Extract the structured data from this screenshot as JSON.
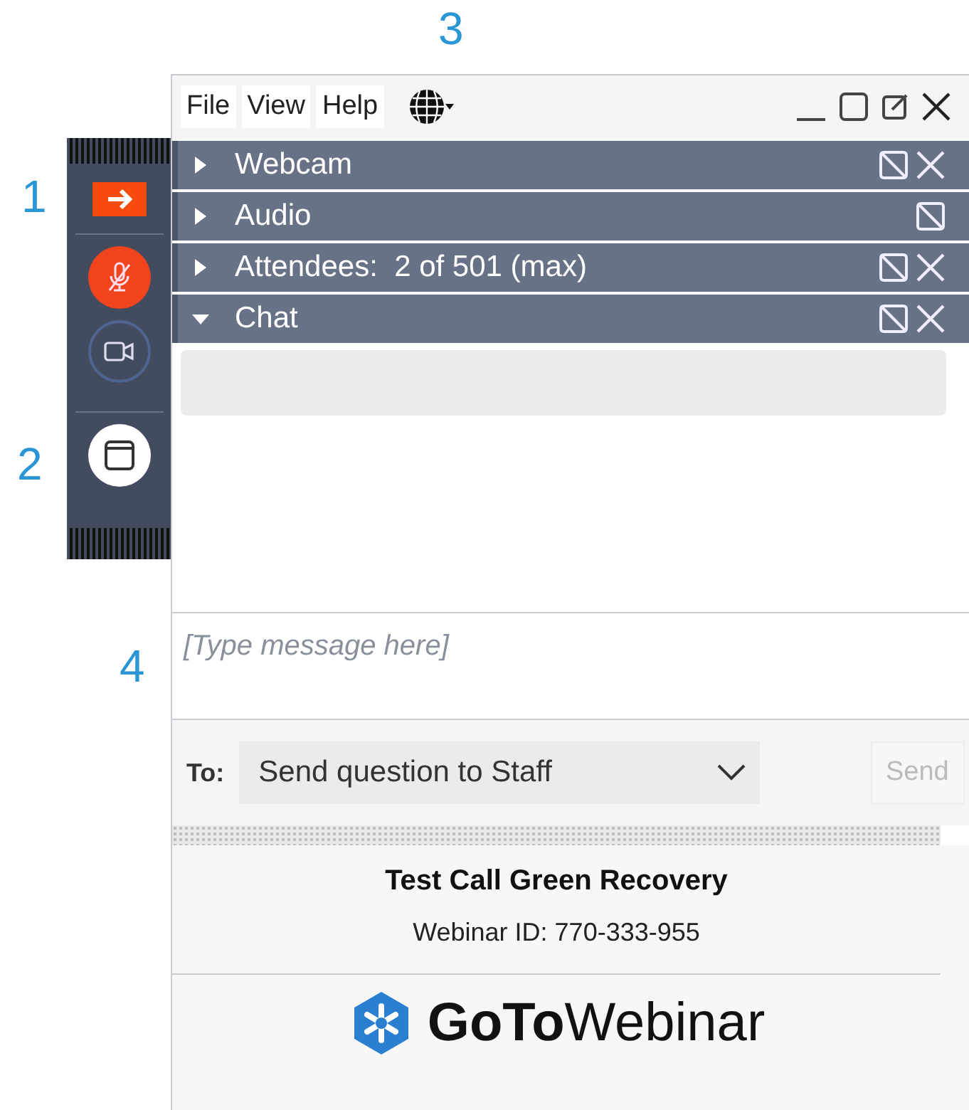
{
  "callouts": [
    "1",
    "2",
    "3",
    "4"
  ],
  "toolbar": {
    "mic_muted": true
  },
  "menu": [
    "File",
    "View",
    "Help"
  ],
  "panels": [
    {
      "title": "Webcam",
      "expanded": false,
      "closable": true
    },
    {
      "title": "Audio",
      "expanded": false,
      "closable": false
    },
    {
      "title": "Attendees:  2 of 501 (max)",
      "expanded": false,
      "closable": true
    },
    {
      "title": "Chat",
      "expanded": true,
      "closable": true
    }
  ],
  "chat": {
    "placeholder": "[Type message here]",
    "to_label": "To:",
    "recipient": "Send question to Staff",
    "send": "Send",
    "send_disabled": true
  },
  "footer": {
    "title": "Test Call Green Recovery",
    "webinar_id": "Webinar ID: 770-333-955",
    "logo": "**GoTo**Webinar"
  }
}
